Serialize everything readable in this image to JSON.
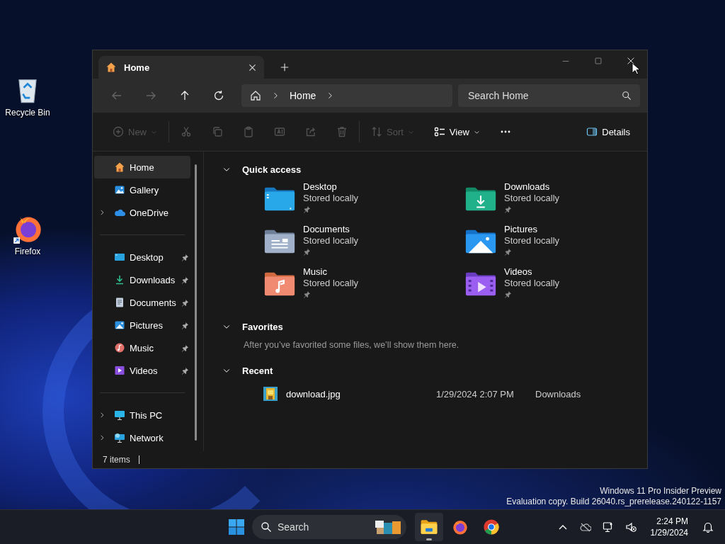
{
  "desktop_icons": [
    {
      "kind": "recycle",
      "label": "Recycle Bin"
    },
    {
      "kind": "firefox",
      "label": "Firefox"
    }
  ],
  "window": {
    "tabs": [
      {
        "label": "Home",
        "selected": true
      }
    ],
    "nav": [
      {
        "kind": "back",
        "disabled": true
      },
      {
        "kind": "forward",
        "disabled": true
      },
      {
        "kind": "up",
        "disabled": false
      },
      {
        "kind": "refresh",
        "disabled": false
      }
    ],
    "breadcrumb": [
      "Home"
    ],
    "search": {
      "placeholder": "Search Home"
    },
    "commands": [
      {
        "kind": "new",
        "label": "New",
        "disabled": true
      },
      {
        "kind": "cut",
        "disabled": true
      },
      {
        "kind": "copy",
        "disabled": true
      },
      {
        "kind": "paste",
        "disabled": true
      },
      {
        "kind": "rename",
        "disabled": true
      },
      {
        "kind": "share",
        "disabled": true
      },
      {
        "kind": "delete",
        "disabled": true
      },
      {
        "kind": "sort",
        "label": "Sort",
        "disabled": true
      },
      {
        "kind": "view",
        "label": "View",
        "disabled": false
      },
      {
        "kind": "more",
        "disabled": false
      }
    ],
    "details_button": "Details",
    "sidebar": [
      [
        {
          "label": "Home",
          "selected": true,
          "expandable": false,
          "pinned": false
        },
        {
          "label": "Gallery",
          "selected": false,
          "expandable": false,
          "pinned": false
        },
        {
          "label": "OneDrive",
          "selected": false,
          "expandable": true,
          "pinned": false
        }
      ],
      [
        {
          "label": "Desktop",
          "selected": false,
          "expandable": false,
          "pinned": true
        },
        {
          "label": "Downloads",
          "selected": false,
          "expandable": false,
          "pinned": true
        },
        {
          "label": "Documents",
          "selected": false,
          "expandable": false,
          "pinned": true
        },
        {
          "label": "Pictures",
          "selected": false,
          "expandable": false,
          "pinned": true
        },
        {
          "label": "Music",
          "selected": false,
          "expandable": false,
          "pinned": true
        },
        {
          "label": "Videos",
          "selected": false,
          "expandable": false,
          "pinned": true
        }
      ],
      [
        {
          "label": "This PC",
          "selected": false,
          "expandable": true,
          "pinned": false
        },
        {
          "label": "Network",
          "selected": false,
          "expandable": true,
          "pinned": false
        }
      ]
    ],
    "quick_access": {
      "title": "Quick access",
      "expanded": true,
      "items": [
        {
          "name": "Desktop",
          "status": "Stored locally",
          "kind": "desktop",
          "pinned": true
        },
        {
          "name": "Downloads",
          "status": "Stored locally",
          "kind": "downloads",
          "pinned": true
        },
        {
          "name": "Documents",
          "status": "Stored locally",
          "kind": "documents",
          "pinned": true
        },
        {
          "name": "Pictures",
          "status": "Stored locally",
          "kind": "pictures",
          "pinned": true
        },
        {
          "name": "Music",
          "status": "Stored locally",
          "kind": "music",
          "pinned": true
        },
        {
          "name": "Videos",
          "status": "Stored locally",
          "kind": "videos",
          "pinned": true
        }
      ]
    },
    "favorites": {
      "title": "Favorites",
      "expanded": true,
      "message": "After you’ve favorited some files, we’ll show them here."
    },
    "recent": {
      "title": "Recent",
      "expanded": true,
      "files": [
        {
          "name": "download.jpg",
          "date": "1/29/2024 2:07 PM",
          "location": "Downloads"
        }
      ]
    },
    "status_bar": {
      "count": "7 items"
    }
  },
  "watermark_lines": [
    "Windows 11 Pro Insider Preview",
    "Evaluation copy. Build 26040.rs_prerelease.240122-1157"
  ],
  "taskbar": {
    "search_placeholder": "Search",
    "apps": [
      {
        "kind": "explorer",
        "running": true
      },
      {
        "kind": "firefox",
        "running": false
      },
      {
        "kind": "chrome",
        "running": false
      }
    ],
    "time": "2:24 PM",
    "date": "1/29/2024"
  }
}
